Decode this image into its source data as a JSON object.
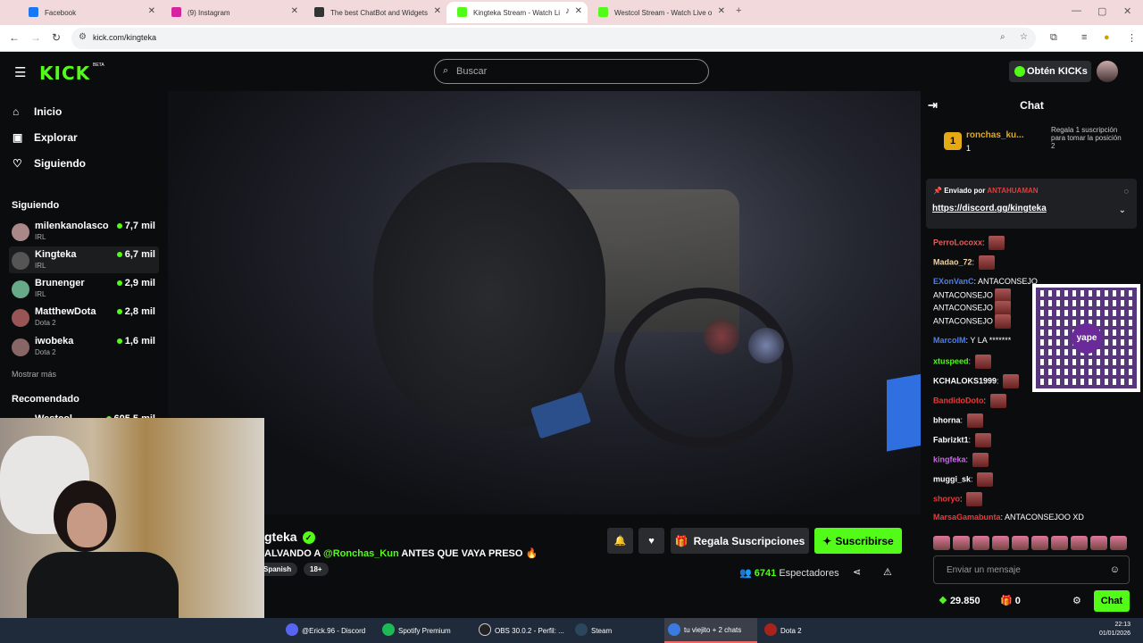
{
  "browser": {
    "tabs": [
      {
        "label": "Facebook",
        "color": "#1877f2"
      },
      {
        "label": "(9) Instagram",
        "color": "#d6249f"
      },
      {
        "label": "The best ChatBot and Widgets",
        "color": "#333333"
      },
      {
        "label": "Kingteka Stream - Watch Li",
        "color": "#53fc18"
      },
      {
        "label": "Westcol Stream - Watch Live o",
        "color": "#53fc18"
      }
    ],
    "url": "kick.com/kingteka"
  },
  "header": {
    "logo": "KICK",
    "beta": "BETA",
    "search_placeholder": "Buscar",
    "kicks_label": "Obtén KICKs"
  },
  "sidebar": {
    "nav": [
      {
        "label": "Inicio",
        "icon": "home-icon"
      },
      {
        "label": "Explorar",
        "icon": "explore-icon"
      },
      {
        "label": "Siguiendo",
        "icon": "heart-icon"
      }
    ],
    "following_title": "Siguiendo",
    "following": [
      {
        "name": "milenkanolasco",
        "category": "IRL",
        "viewers": "7,7 mil"
      },
      {
        "name": "Kingteka",
        "category": "IRL",
        "viewers": "6,7 mil"
      },
      {
        "name": "Brunenger",
        "category": "IRL",
        "viewers": "2,9 mil"
      },
      {
        "name": "MatthewDota",
        "category": "Dota 2",
        "viewers": "2,8 mil"
      },
      {
        "name": "iwobeka",
        "category": "Dota 2",
        "viewers": "1,6 mil"
      }
    ],
    "show_more": "Mostrar más",
    "recommended_title": "Recomendado",
    "recommended": [
      {
        "name": "Westcol",
        "viewers": "605,5 mil"
      }
    ]
  },
  "stream": {
    "name": "gteka",
    "title_prefix": "ALVANDO A ",
    "title_mention": "@Ronchas_Kun",
    "title_suffix": " ANTES QUE VAYA PRESO 🔥",
    "tags": [
      "Spanish",
      "18+"
    ],
    "gift_label": "Regala Suscripciones",
    "subscribe_label": "Suscribirse",
    "viewers_count": "6741",
    "viewers_label": "Espectadores"
  },
  "chat": {
    "title": "Chat",
    "top_gifter": {
      "rank": "1",
      "name": "ronchas_ku...",
      "count": "1"
    },
    "gift_prompt": "Regala 1 suscripción para tomar la posición 2",
    "pinned": {
      "sent_by_label": "Enviado por",
      "sent_by_user": "ANTAHUAMAN",
      "link": "https://discord.gg/kingteka"
    },
    "messages": [
      {
        "user": "PerroLocoxx",
        "color": "#e95c5c",
        "text": "",
        "emote": true
      },
      {
        "user": "Madao_72",
        "color": "#f2d1a0",
        "text": "",
        "emote": true
      },
      {
        "user": "EXonVanC",
        "color": "#4f7fe8",
        "text": "ANTACONSEJO",
        "emote": false
      },
      {
        "user": "",
        "color": "#ffffff",
        "text": "ANTACONSEJO",
        "emote": true
      },
      {
        "user": "",
        "color": "#ffffff",
        "text": "ANTACONSEJO",
        "emote": true
      },
      {
        "user": "",
        "color": "#ffffff",
        "text": "ANTACONSEJO",
        "emote": true
      },
      {
        "user": "MarcolM",
        "color": "#4f7fe8",
        "text": "Y LA *******",
        "emote": false
      },
      {
        "user": "xtuspeed",
        "color": "#53fc18",
        "text": "",
        "emote": true
      },
      {
        "user": "KCHALOKS1999",
        "color": "#ffffff",
        "text": "",
        "emote": true
      },
      {
        "user": "BandidoDoto",
        "color": "#e93a3a",
        "text": "",
        "emote": true
      },
      {
        "user": "bhorna",
        "color": "#ffffff",
        "text": "",
        "emote": true
      },
      {
        "user": "Fabrizkt1",
        "color": "#ffffff",
        "text": "",
        "emote": true
      },
      {
        "user": "kingfeka",
        "color": "#c86be8",
        "text": "",
        "emote": true
      },
      {
        "user": "muggi_sk",
        "color": "#ffffff",
        "text": "",
        "emote": true
      },
      {
        "user": "shoryo",
        "color": "#e93a3a",
        "text": "",
        "emote": true
      },
      {
        "user": "MarsaGamabunta",
        "color": "#e93a3a",
        "text": "ANTACONSEJOO XD",
        "emote": false
      }
    ],
    "qr_label": "yape",
    "input_placeholder": "Enviar un mensaje",
    "points": "29.850",
    "gifts": "0",
    "chat_button": "Chat"
  },
  "taskbar": {
    "items": [
      {
        "label": "@Erick.96 - Discord",
        "color": "#5865f2"
      },
      {
        "label": "Spotify Premium",
        "color": "#1db954"
      },
      {
        "label": "OBS 30.0.2 - Perfil: ...",
        "color": "#222222"
      },
      {
        "label": "Steam",
        "color": "#1b2838"
      },
      {
        "label": "tu viejito + 2 chats",
        "color": "#3b7be0"
      },
      {
        "label": "Dota 2",
        "color": "#a8231b"
      }
    ],
    "time": "22:13",
    "date": "01/01/2026"
  }
}
